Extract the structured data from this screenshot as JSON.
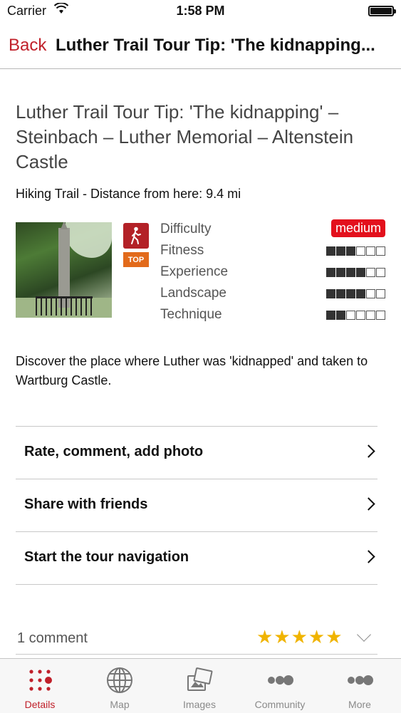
{
  "status_bar": {
    "carrier": "Carrier",
    "time": "1:58 PM"
  },
  "nav": {
    "back_label": "Back",
    "title": "Luther Trail Tour Tip: 'The kidnapping..."
  },
  "tour": {
    "title": "Luther Trail Tour Tip: 'The kidnapping' – Steinbach – Luther Memorial – Altenstein Castle",
    "subtitle": "Hiking Trail - Distance from here: 9.4 mi",
    "top_badge": "TOP",
    "difficulty_label": "Difficulty",
    "difficulty_value": "medium",
    "ratings": [
      {
        "label": "Fitness",
        "level": 3,
        "max": 6
      },
      {
        "label": "Experience",
        "level": 4,
        "max": 6
      },
      {
        "label": "Landscape",
        "level": 4,
        "max": 6
      },
      {
        "label": "Technique",
        "level": 2,
        "max": 6
      }
    ],
    "description": "Discover the place where Luther was 'kidnapped' and taken to Wartburg Castle."
  },
  "menu": [
    {
      "label": "Rate, comment, add photo"
    },
    {
      "label": "Share with friends"
    },
    {
      "label": "Start the tour navigation"
    }
  ],
  "comments": {
    "count_text": "1 comment",
    "stars": "★★★★★",
    "rating": 5
  },
  "tabbar": [
    {
      "label": "Details",
      "icon": "details-dots-icon",
      "active": true
    },
    {
      "label": "Map",
      "icon": "globe-icon",
      "active": false
    },
    {
      "label": "Images",
      "icon": "images-icon",
      "active": false
    },
    {
      "label": "Community",
      "icon": "community-icon",
      "active": false
    },
    {
      "label": "More",
      "icon": "more-icon",
      "active": false
    }
  ],
  "colors": {
    "accent": "#c0202a",
    "badge_red": "#e3101c",
    "top_orange": "#e26a1b",
    "star": "#f0b400"
  }
}
